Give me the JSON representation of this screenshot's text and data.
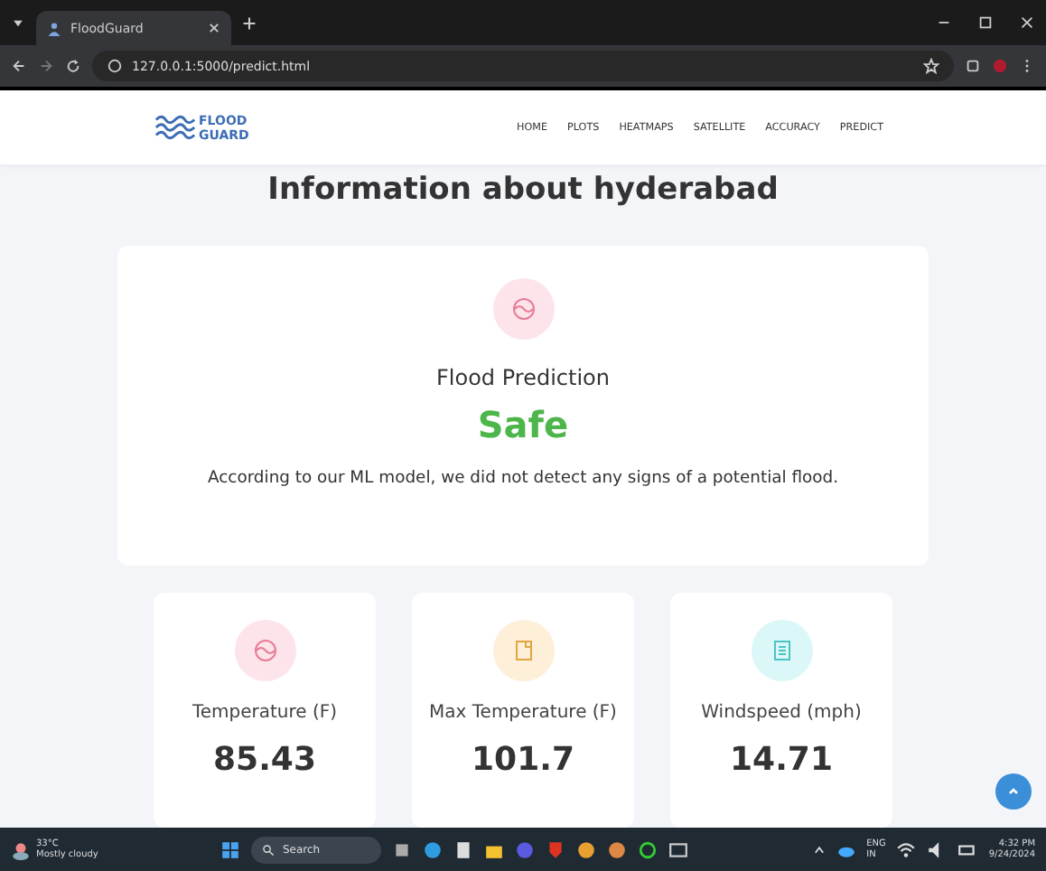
{
  "browser": {
    "tab_title": "FloodGuard",
    "url": "127.0.0.1:5000/predict.html"
  },
  "nav": {
    "logo": [
      "FLOOD",
      "GUARD"
    ],
    "links": [
      "HOME",
      "PLOTS",
      "HEATMAPS",
      "SATELLITE",
      "ACCURACY",
      "PREDICT"
    ]
  },
  "heading": "Information about hyderabad",
  "prediction": {
    "label": "Flood Prediction",
    "result": "Safe",
    "message": "According to our ML model, we did not detect any signs of a potential flood."
  },
  "stats": [
    {
      "kind": "wave",
      "label": "Temperature (F)",
      "value": "85.43",
      "color": "#fde4ea"
    },
    {
      "kind": "doc",
      "label": "Max Temperature (F)",
      "value": "101.7",
      "color": "#fdefd8"
    },
    {
      "kind": "list",
      "label": "Windspeed (mph)",
      "value": "14.71",
      "color": "#dcf7f7"
    }
  ],
  "taskbar": {
    "weather": [
      "33°C",
      "Mostly cloudy"
    ],
    "search": "Search",
    "lang": [
      "ENG",
      "IN"
    ],
    "clock": [
      "4:32 PM",
      "9/24/2024"
    ]
  }
}
